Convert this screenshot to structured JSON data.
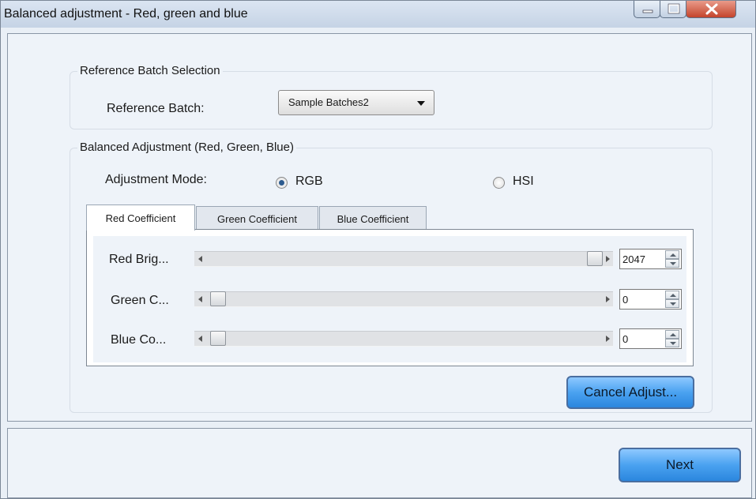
{
  "window": {
    "title": "Balanced adjustment - Red, green and blue"
  },
  "reference_group": {
    "legend": "Reference Batch Selection",
    "batch_label": "Reference Batch:",
    "batch_value": "Sample Batches2"
  },
  "balance_group": {
    "legend": "Balanced Adjustment (Red, Green, Blue)",
    "mode_label": "Adjustment Mode:",
    "mode_options": [
      "RGB",
      "HSI"
    ],
    "mode_selected": "RGB",
    "tabs": [
      "Red Coefficient",
      "Green Coefficient",
      "Blue Coefficient"
    ],
    "active_tab": "Red Coefficient",
    "sliders": [
      {
        "label": "Red Brig...",
        "value": "2047",
        "level": 1.0
      },
      {
        "label": "Green C...",
        "value": "0",
        "level": 0.0
      },
      {
        "label": "Blue Co...",
        "value": "0",
        "level": 0.0
      }
    ],
    "cancel_label": "Cancel Adjust..."
  },
  "footer": {
    "next_label": "Next"
  },
  "colors": {
    "accent_button": "#4aa2f0",
    "close_button": "#c4442c",
    "radio_selected": "#2d5b8f"
  }
}
